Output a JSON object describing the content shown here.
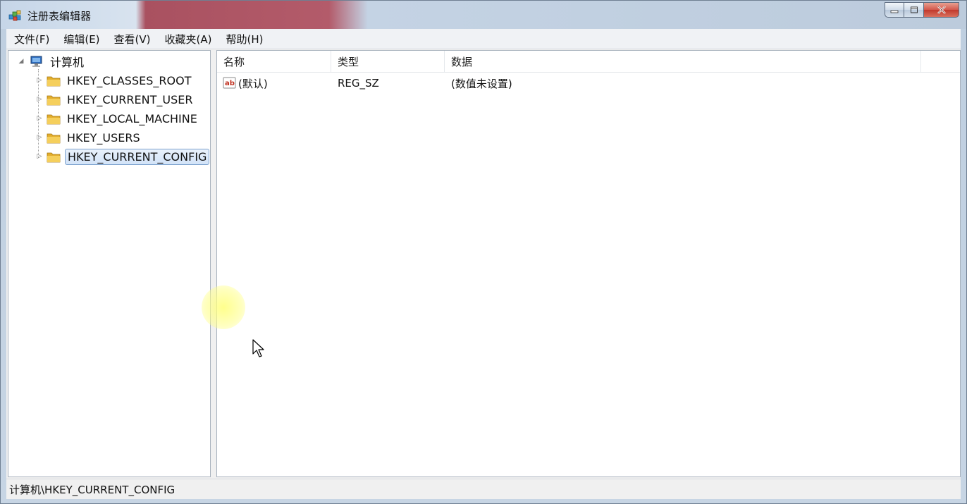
{
  "window": {
    "title": "注册表编辑器",
    "icons": {
      "app": "registry-editor-icon",
      "minimize": "minimize-icon",
      "maximize": "maximize-icon",
      "close": "close-icon"
    }
  },
  "menubar": {
    "items": [
      "文件(F)",
      "编辑(E)",
      "查看(V)",
      "收藏夹(A)",
      "帮助(H)"
    ]
  },
  "tree": {
    "root": {
      "label": "计算机",
      "expanded": true,
      "icon": "computer-icon"
    },
    "children": [
      {
        "label": "HKEY_CLASSES_ROOT",
        "icon": "folder-icon",
        "selected": false
      },
      {
        "label": "HKEY_CURRENT_USER",
        "icon": "folder-icon",
        "selected": false
      },
      {
        "label": "HKEY_LOCAL_MACHINE",
        "icon": "folder-icon",
        "selected": false
      },
      {
        "label": "HKEY_USERS",
        "icon": "folder-icon",
        "selected": false
      },
      {
        "label": "HKEY_CURRENT_CONFIG",
        "icon": "folder-icon",
        "selected": true
      }
    ]
  },
  "list": {
    "columns": [
      "名称",
      "类型",
      "数据"
    ],
    "rows": [
      {
        "name": "(默认)",
        "type": "REG_SZ",
        "data": "(数值未设置)",
        "icon": "string-value-icon"
      }
    ]
  },
  "statusbar": {
    "path": "计算机\\HKEY_CURRENT_CONFIG"
  },
  "colors": {
    "selection_border": "#7da2ce",
    "selection_fill": "#d2e3f8",
    "folder": "#e8b840"
  }
}
